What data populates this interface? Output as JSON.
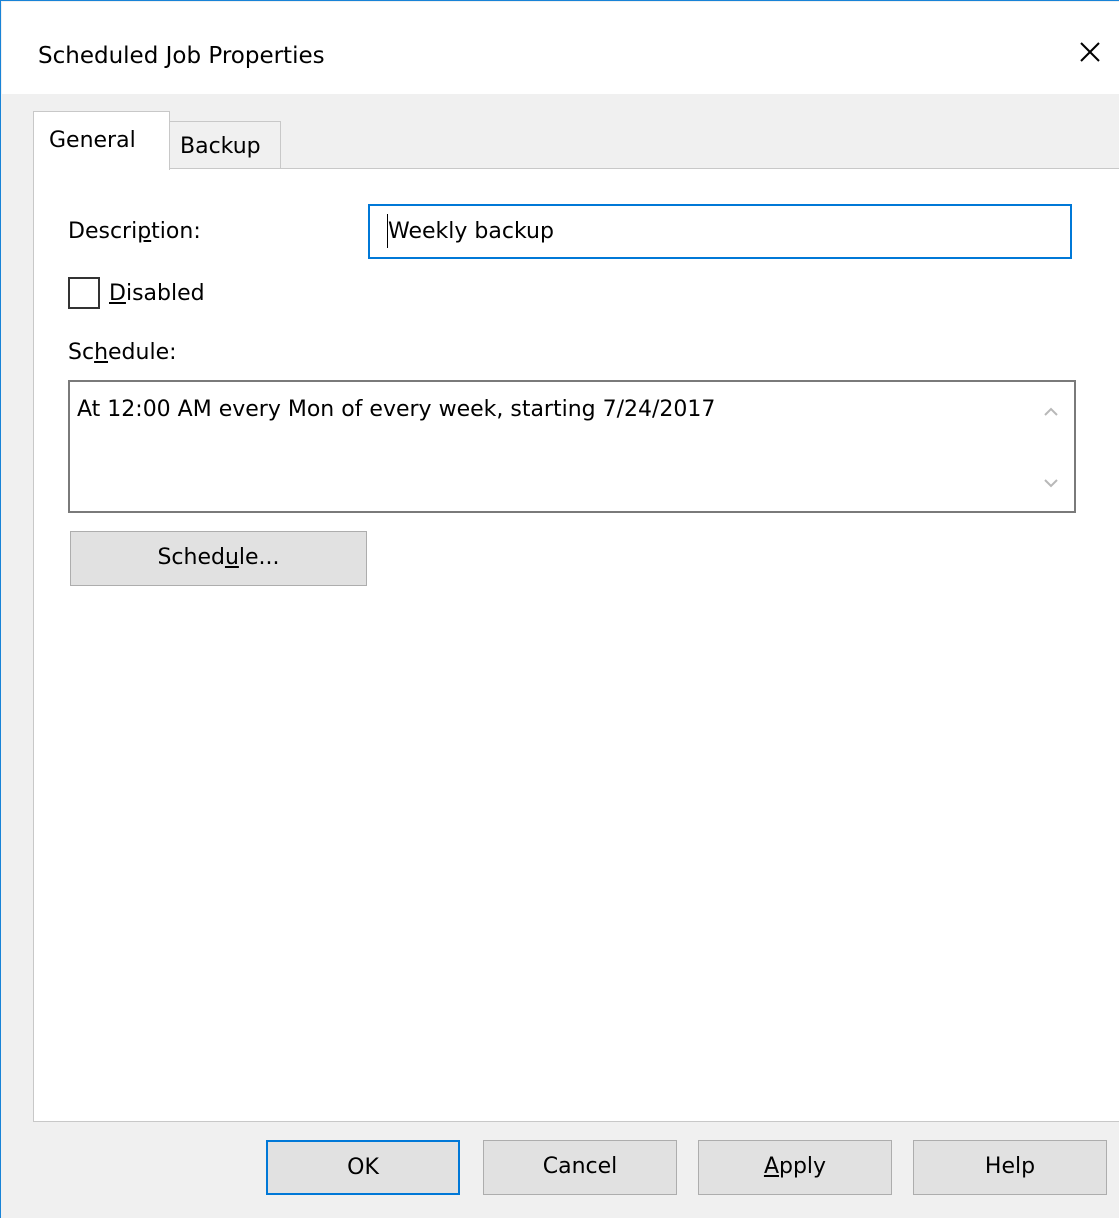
{
  "window": {
    "title": "Scheduled Job Properties",
    "close_icon": "close-icon"
  },
  "tabs": [
    {
      "label": "General",
      "active": true
    },
    {
      "label": "Backup",
      "active": false
    }
  ],
  "general": {
    "description_label_pre": "Descri",
    "description_label_u": "p",
    "description_label_post": "tion:",
    "description_value": "Weekly backup",
    "disabled_label_u": "D",
    "disabled_label_post": "isabled",
    "disabled_checked": false,
    "schedule_label_pre": "Sc",
    "schedule_label_u": "h",
    "schedule_label_post": "edule:",
    "schedule_text": "At 12:00 AM every Mon of every week, starting 7/24/2017",
    "schedule_button_pre": "Sched",
    "schedule_button_u": "u",
    "schedule_button_post": "le..."
  },
  "footer": {
    "ok_label": "OK",
    "cancel_label": "Cancel",
    "apply_label_u": "A",
    "apply_label_post": "pply",
    "help_label": "Help"
  },
  "colors": {
    "accent": "#0078d7",
    "window_border": "#1883d7",
    "dialog_background": "#f0f0f0",
    "button_face": "#e1e1e1"
  }
}
